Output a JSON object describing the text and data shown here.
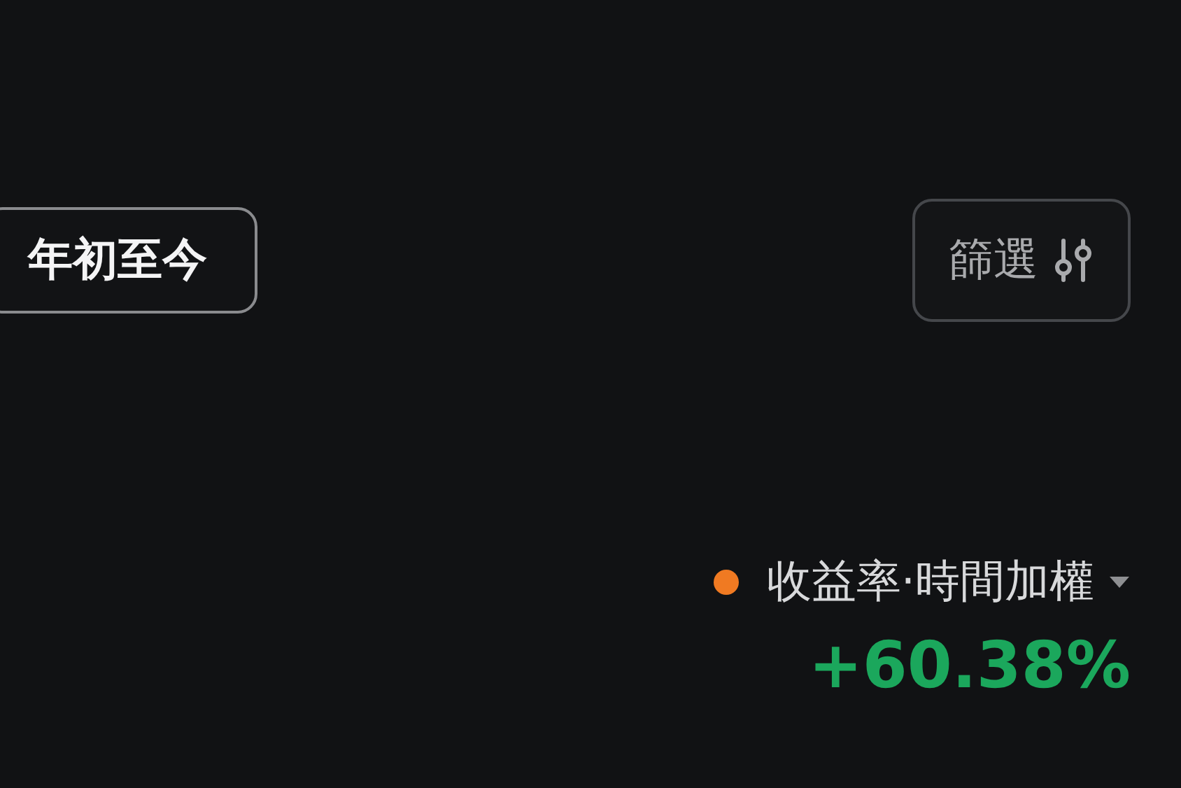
{
  "period_button": {
    "label": "年初至今"
  },
  "filter_button": {
    "label": "篩選"
  },
  "metric": {
    "label": "收益率·時間加權",
    "value": "+60.38%"
  }
}
